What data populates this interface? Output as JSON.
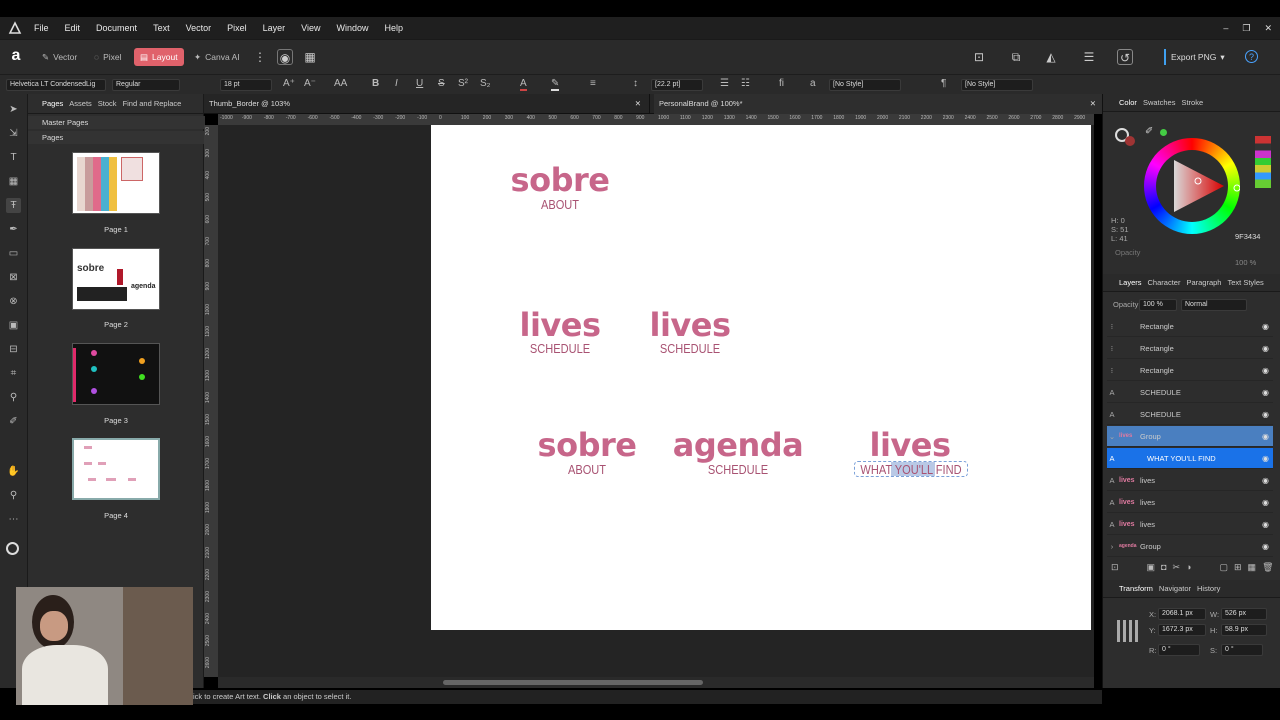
{
  "menu": [
    "File",
    "Edit",
    "Document",
    "Text",
    "Vector",
    "Pixel",
    "Layer",
    "View",
    "Window",
    "Help"
  ],
  "personas": [
    "Vector",
    "Pixel",
    "Layout",
    "Canva AI"
  ],
  "export_label": "Export PNG",
  "ctx": {
    "font_family": "Helvetica LT CondensedLig",
    "font_style": "Regular",
    "font_size": "18 pt",
    "leading": "[22.2 pt]",
    "para_style": "[No Style]",
    "char_style": "[No Style]"
  },
  "pages_tabs": [
    "Pages",
    "Assets",
    "Stock",
    "Find and Replace"
  ],
  "master_pages": "Master Pages",
  "pages_section": "Pages",
  "pages": [
    "Page 1",
    "Page 2",
    "Page 3",
    "Page 4"
  ],
  "doc_tabs": [
    "Thumb_Border @ 103%",
    "PersonalBrand @ 100%*"
  ],
  "ruler_h": [
    "-1000",
    "-900",
    "-800",
    "-700",
    "-600",
    "-500",
    "-400",
    "-300",
    "-200",
    "-100",
    "0",
    "100",
    "200",
    "300",
    "400",
    "500",
    "600",
    "700",
    "800",
    "900",
    "1000",
    "1100",
    "1200",
    "1300",
    "1400",
    "1500",
    "1600",
    "1700",
    "1800",
    "1900",
    "2000",
    "2100",
    "2200",
    "2300",
    "2400",
    "2500",
    "2600",
    "2700",
    "2800",
    "2900"
  ],
  "ruler_v": [
    "200",
    "300",
    "400",
    "500",
    "600",
    "700",
    "800",
    "900",
    "1000",
    "1100",
    "1200",
    "1300",
    "1400",
    "1500",
    "1600",
    "1700",
    "1800",
    "1900",
    "2000",
    "2100",
    "2200",
    "2300",
    "2400",
    "2500",
    "2600"
  ],
  "artboard": {
    "w1": {
      "word": "sobre",
      "sub": "ABOUT"
    },
    "w2": {
      "word": "lives",
      "sub": "SCHEDULE"
    },
    "w3": {
      "word": "lives",
      "sub": "SCHEDULE"
    },
    "w4": {
      "word": "sobre",
      "sub": "ABOUT"
    },
    "w5": {
      "word": "agenda",
      "sub": "SCHEDULE"
    },
    "w6": {
      "word": "lives",
      "sub": "WHAT YOU'LL FIND"
    }
  },
  "accent_color": "#c7668a",
  "status": {
    "pre": "ick to create Art text. ",
    "click": "Click",
    "post": " an object to select it."
  },
  "color_tabs": [
    "Color",
    "Swatches",
    "Stroke"
  ],
  "color": {
    "h": "H: 0",
    "s": "S: 51",
    "l": "L: 41",
    "hex": "9F3434",
    "opacity_label": "Opacity",
    "opacity": "100 %"
  },
  "layers_tabs": [
    "Layers",
    "Character",
    "Paragraph",
    "Text Styles"
  ],
  "layers_opacity_label": "Opacity:",
  "layers_opacity": "100 %",
  "blend": "Normal",
  "layers": [
    {
      "name": "Rectangle",
      "type": "rect"
    },
    {
      "name": "Rectangle",
      "type": "rect"
    },
    {
      "name": "Rectangle",
      "type": "rect"
    },
    {
      "name": "SCHEDULE",
      "type": "text"
    },
    {
      "name": "SCHEDULE",
      "type": "text"
    },
    {
      "name": "Group",
      "type": "group"
    },
    {
      "name": "WHAT YOU'LL FIND",
      "type": "text"
    },
    {
      "name": "lives",
      "type": "text"
    },
    {
      "name": "lives",
      "type": "text"
    },
    {
      "name": "lives",
      "type": "text"
    },
    {
      "name": "Group",
      "type": "group"
    }
  ],
  "transform_tabs": [
    "Transform",
    "Navigator",
    "History"
  ],
  "transform": {
    "x_label": "X:",
    "x": "2068.1 px",
    "y_label": "Y:",
    "y": "1672.3 px",
    "w_label": "W:",
    "w": "526 px",
    "h_label": "H:",
    "h": "58.9 px",
    "r_label": "R:",
    "r": "0 °",
    "s_label": "S:",
    "s": "0 °"
  }
}
